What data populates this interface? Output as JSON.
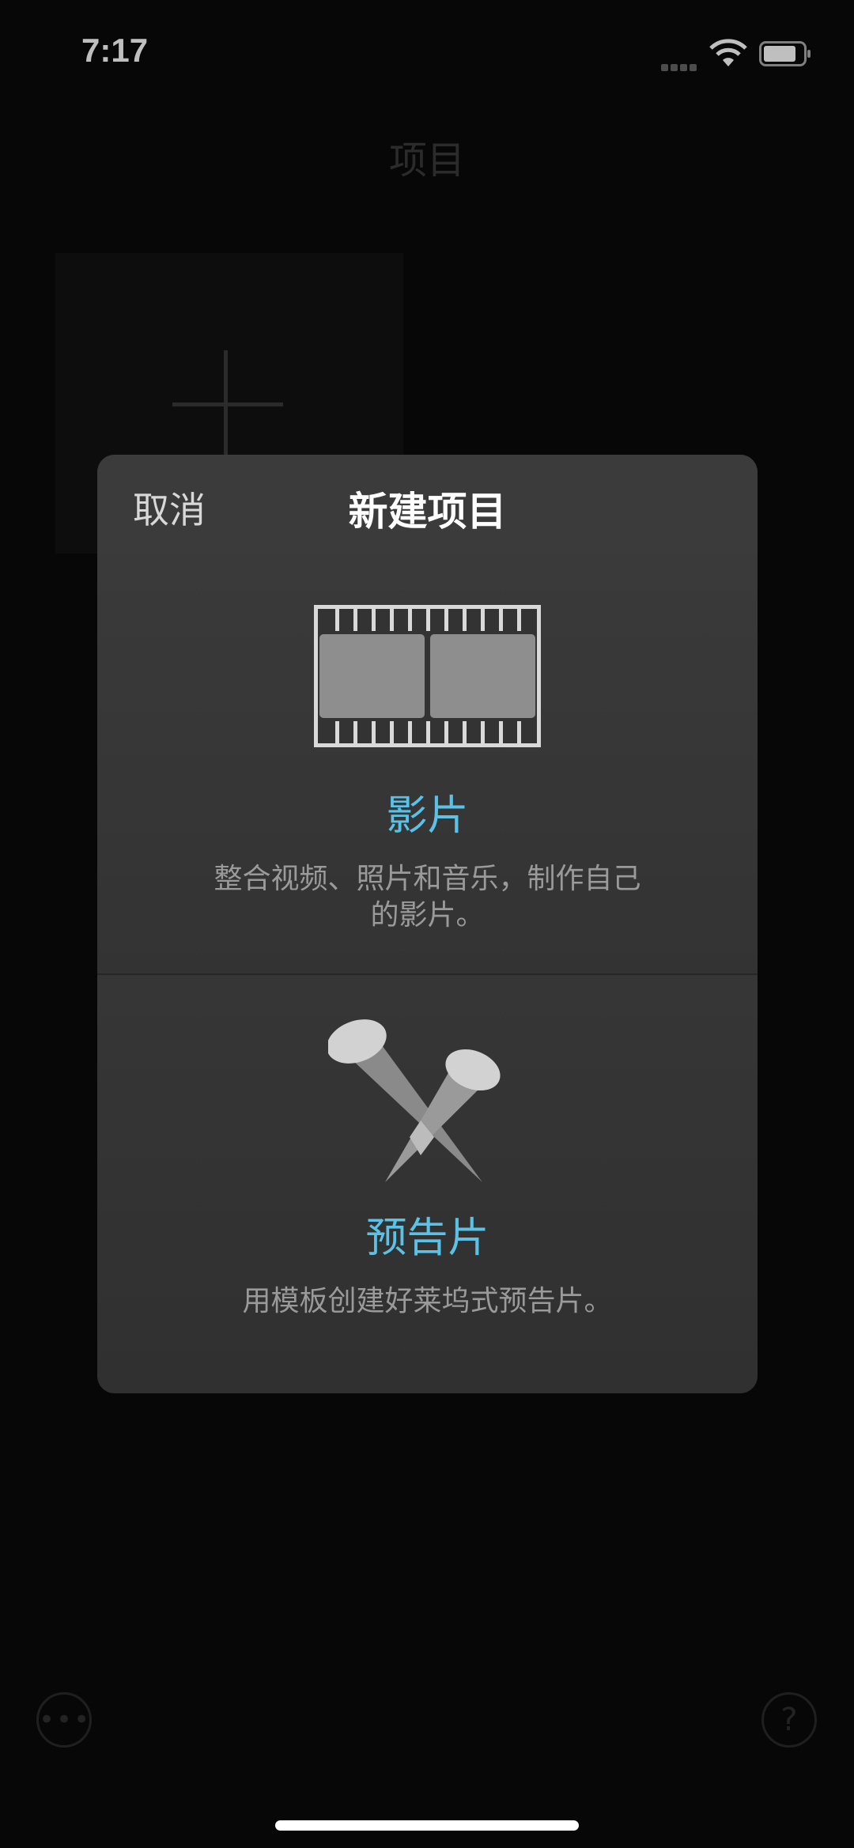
{
  "status_bar": {
    "time": "7:17"
  },
  "background": {
    "page_title": "项目",
    "more_button_glyph": "•••",
    "help_button_glyph": "?"
  },
  "dialog": {
    "cancel_label": "取消",
    "title": "新建项目",
    "options": [
      {
        "icon": "film-strip-icon",
        "label": "影片",
        "description": "整合视频、照片和音乐，制作自己的影片。"
      },
      {
        "icon": "spotlight-icon",
        "label": "预告片",
        "description": "用模板创建好莱坞式预告片。"
      }
    ]
  },
  "colors": {
    "accent": "#5bc2e7",
    "sheet": "#333333"
  }
}
